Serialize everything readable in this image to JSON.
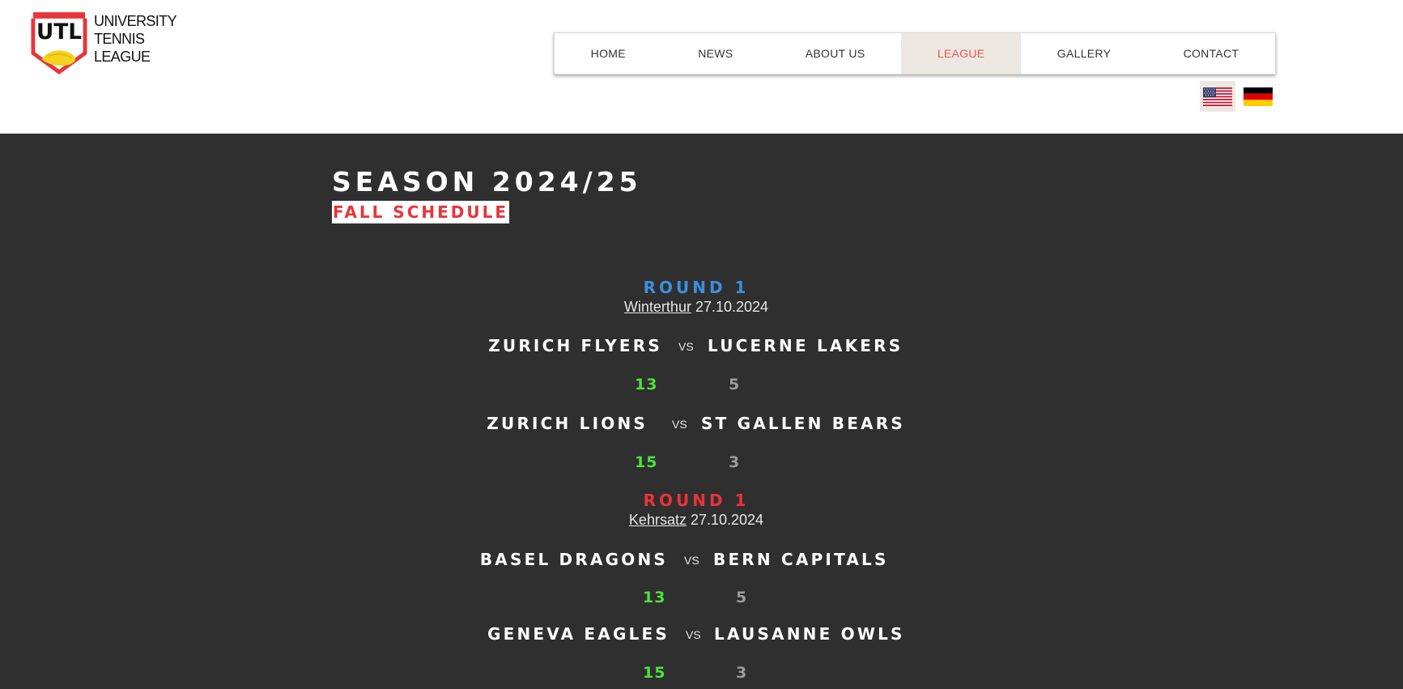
{
  "brand": {
    "abbr": "UTL",
    "name_lines": [
      "UNIVERSITY",
      "TENNIS",
      "LEAGUE"
    ],
    "red": "#e8343a",
    "ball_yellow": "#f4d21f"
  },
  "nav": {
    "items": [
      {
        "label": "HOME",
        "active": false
      },
      {
        "label": "NEWS",
        "active": false
      },
      {
        "label": "ABOUT US",
        "active": false
      },
      {
        "label": "LEAGUE",
        "active": true
      },
      {
        "label": "GALLERY",
        "active": false
      },
      {
        "label": "CONTACT",
        "active": false
      }
    ],
    "active_color": "#e8595b",
    "active_bg": "#ece8e1"
  },
  "languages": [
    {
      "name": "english-us-flag-icon",
      "active": true
    },
    {
      "name": "german-flag-icon",
      "active": false
    }
  ],
  "season": {
    "title": "SEASON 2024/25",
    "subtitle": "FALL SCHEDULE"
  },
  "rounds": [
    {
      "title": "ROUND 1",
      "title_color": "#3d8ee0",
      "venue": "Winterthur",
      "date": "27.10.2024",
      "matches": [
        {
          "home": "ZURICH FLYERS",
          "vs": "VS",
          "away": "LUCERNE LAKERS",
          "home_score": "13",
          "away_score": "5"
        },
        {
          "home": "ZURICH LIONS",
          "vs": "VS",
          "away": "ST GALLEN BEARS",
          "home_score": "15",
          "away_score": "3"
        }
      ]
    },
    {
      "title": "ROUND 1",
      "title_color": "#e8343a",
      "venue": "Kehrsatz",
      "date": "27.10.2024",
      "matches": [
        {
          "home": "BASEL DRAGONS",
          "vs": "VS",
          "away": "BERN CAPITALS",
          "home_score": "13",
          "away_score": "5"
        },
        {
          "home": "GENEVA EAGLES",
          "vs": "VS",
          "away": "LAUSANNE OWLS",
          "home_score": "15",
          "away_score": "3"
        }
      ]
    }
  ]
}
